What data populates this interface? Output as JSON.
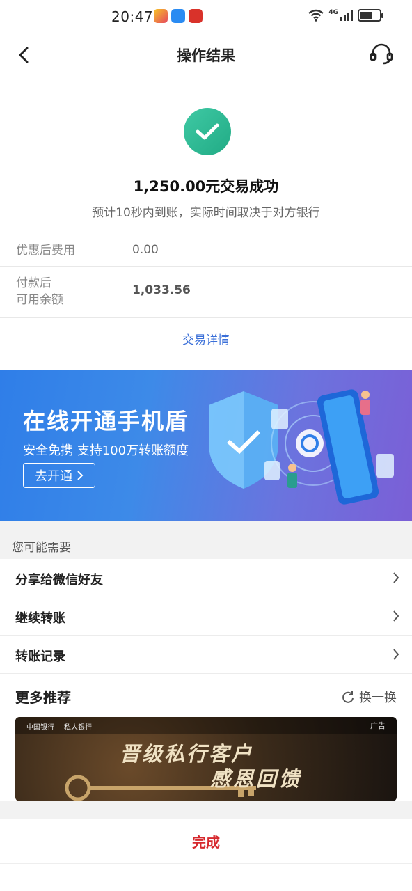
{
  "status_bar": {
    "time": "20:47",
    "network": "4G"
  },
  "nav": {
    "title": "操作结果"
  },
  "result": {
    "title": "1,250.00元交易成功",
    "subtitle": "预计10秒内到账，实际时间取决于对方银行"
  },
  "info_rows": [
    {
      "label": "优惠后费用",
      "value": "0.00"
    },
    {
      "label": "付款后\n可用余额",
      "value": "1,033.56"
    }
  ],
  "detail_link": "交易详情",
  "banner": {
    "title": "在线开通手机盾",
    "subtitle": "安全免携 支持100万转账额度",
    "cta": "去开通"
  },
  "section_title": "您可能需要",
  "list_items": [
    {
      "label": "分享给微信好友"
    },
    {
      "label": "继续转账"
    },
    {
      "label": "转账记录"
    }
  ],
  "more": {
    "title": "更多推荐",
    "refresh": "换一换"
  },
  "ad": {
    "tag": "广告",
    "logos": [
      "中国银行",
      "私人银行"
    ],
    "line1": "晋级私行客户",
    "line2": "感恩回馈"
  },
  "done_button": "完成",
  "colors": {
    "accent_blue": "#3a6fd8",
    "success_green": "#2fb890",
    "done_red": "#d6282d"
  }
}
